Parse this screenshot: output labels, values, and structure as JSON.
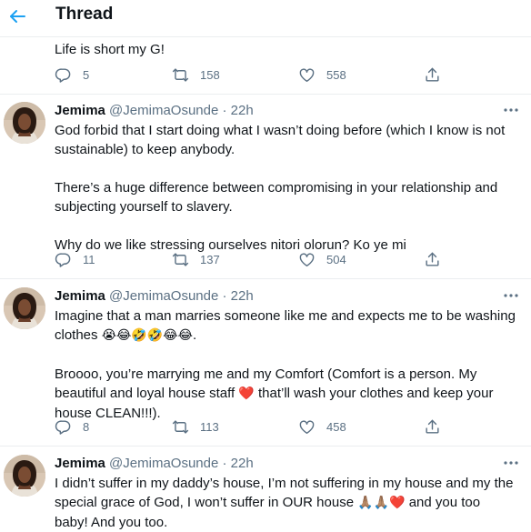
{
  "header": {
    "title": "Thread"
  },
  "continuation": {
    "text": "Life is short my G!",
    "replies": "5",
    "retweets": "158",
    "likes": "558"
  },
  "tweets": [
    {
      "name": "Jemima",
      "handle": "@JemimaOsunde",
      "dot": "·",
      "time": "22h",
      "text": "God forbid that I start doing what I wasn’t doing before (which I know is not sustainable) to keep anybody.\n\nThere’s a huge difference between compromising in your relationship and subjecting yourself to slavery.\n\nWhy do we like stressing ourselves nitori olorun? Ko ye mi",
      "replies": "11",
      "retweets": "137",
      "likes": "504"
    },
    {
      "name": "Jemima",
      "handle": "@JemimaOsunde",
      "dot": "·",
      "time": "22h",
      "text_a": "Imagine that a man marries someone like me and expects me to be washing\nclothes ",
      "emoji_a": "😭😂🤣🤣😂😂",
      "text_b": ".\n\nBroooo, you’re marrying me and my Comfort (Comfort is a person. My\nbeautiful and loyal house staff ",
      "emoji_b": "❤️",
      "text_c": " that’ll wash your clothes and keep your\nhouse CLEAN!!!).",
      "replies": "8",
      "retweets": "113",
      "likes": "458"
    },
    {
      "name": "Jemima",
      "handle": "@JemimaOsunde",
      "dot": "·",
      "time": "22h",
      "text_a": "I didn’t suffer in my daddy’s house, I’m not suffering in my house and my the\nspecial grace of God, I won’t suffer in OUR house ",
      "emoji_a": "🙏🏽🙏🏽❤️",
      "text_b": " and you too\nbaby! And you too."
    }
  ],
  "colors": {
    "accent": "#1da1f2",
    "muted": "#5b7083",
    "text": "#0f1419",
    "heart": "#e0245e"
  }
}
